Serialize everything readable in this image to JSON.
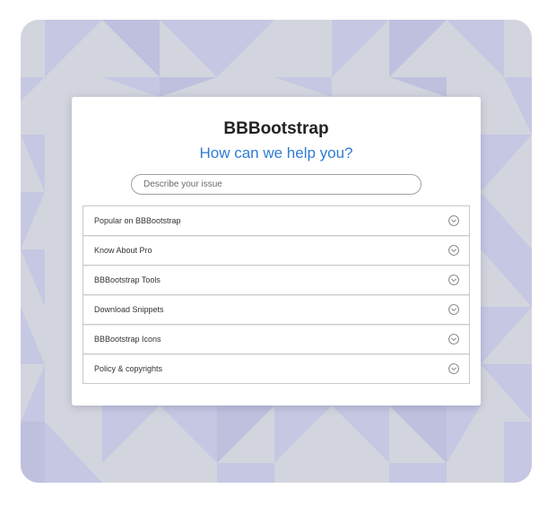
{
  "header": {
    "brand": "BBBootstrap",
    "subtitle": "How can we help you?"
  },
  "search": {
    "placeholder": "Describe your issue",
    "value": ""
  },
  "accordion": {
    "items": [
      {
        "label": "Popular on BBBootstrap",
        "icon": "chevron-down-circle-icon"
      },
      {
        "label": "Know About Pro",
        "icon": "chevron-down-circle-icon"
      },
      {
        "label": "BBBootstrap Tools",
        "icon": "chevron-down-circle-icon"
      },
      {
        "label": "Download Snippets",
        "icon": "chevron-down-circle-icon"
      },
      {
        "label": "BBBootstrap Icons",
        "icon": "chevron-down-circle-icon"
      },
      {
        "label": "Policy & copyrights",
        "icon": "chevron-down-circle-icon"
      }
    ]
  },
  "colors": {
    "accent": "#2f7bd6",
    "background_base": "#d3d5de",
    "background_pattern": "#c6c6e2",
    "card": "#ffffff"
  }
}
